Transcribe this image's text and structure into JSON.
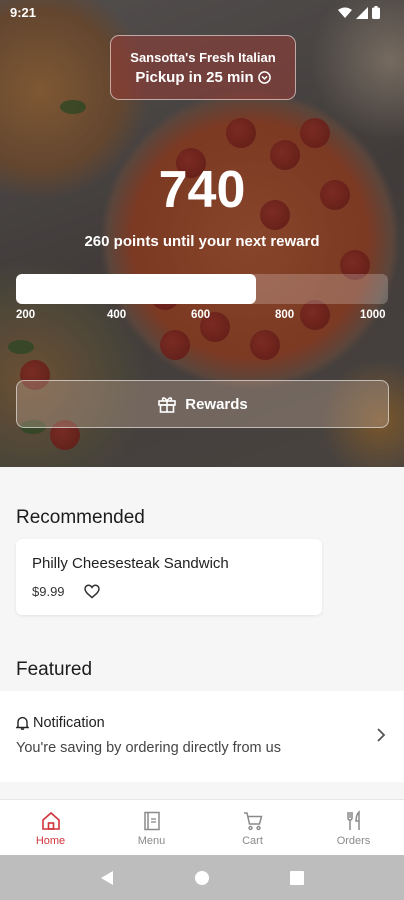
{
  "status_bar": {
    "time": "9:21"
  },
  "location": {
    "name": "Sansotta's Fresh Italian",
    "pickup": "Pickup in 25 min"
  },
  "rewards": {
    "points": "740",
    "subtitle": "260 points until your next reward",
    "progress_fraction": 0.645,
    "ticks": [
      "200",
      "400",
      "600",
      "800",
      "1000"
    ],
    "button_label": "Rewards"
  },
  "recommended": {
    "title": "Recommended",
    "items": [
      {
        "name": "Philly Cheesesteak Sandwich",
        "price": "$9.99"
      }
    ]
  },
  "featured": {
    "title": "Featured",
    "notification_title": "Notification",
    "notification_body": "You're saving by ordering directly from us"
  },
  "bottom_nav": [
    {
      "label": "Home",
      "icon": "home-icon",
      "active": true
    },
    {
      "label": "Menu",
      "icon": "menu-book-icon",
      "active": false
    },
    {
      "label": "Cart",
      "icon": "cart-icon",
      "active": false
    },
    {
      "label": "Orders",
      "icon": "fork-knife-icon",
      "active": false
    }
  ],
  "colors": {
    "accent": "#d0343a",
    "inactive": "#8a8a8a"
  }
}
